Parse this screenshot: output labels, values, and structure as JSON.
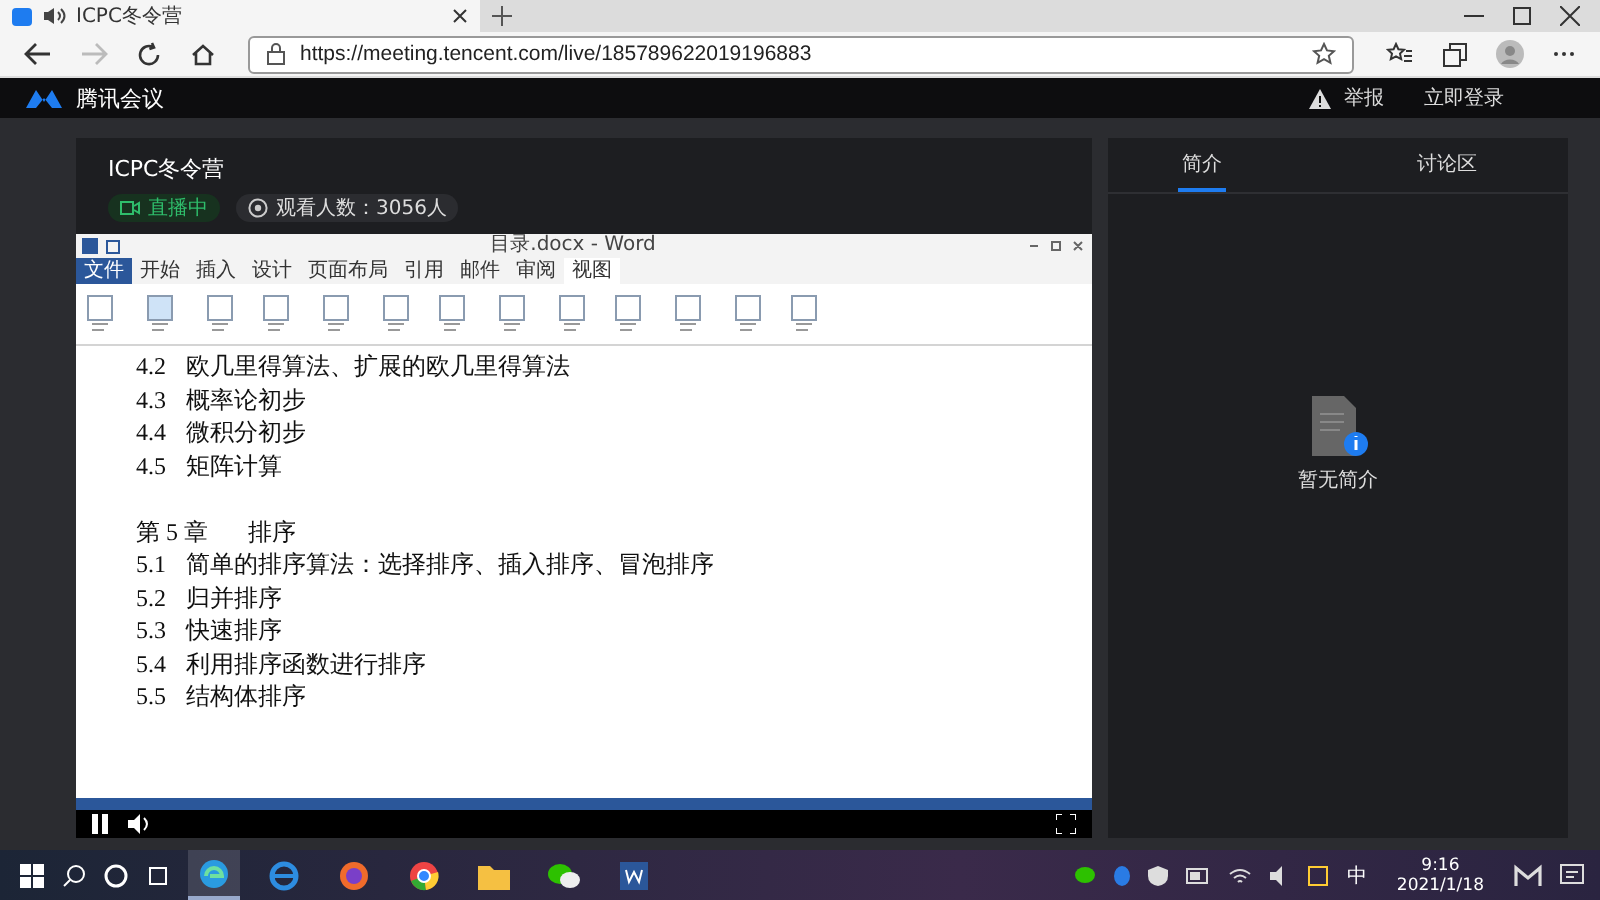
{
  "browser": {
    "tab_title": "ICPC冬令营",
    "url": "https://meeting.tencent.com/live/185789622019196883"
  },
  "site": {
    "logo": "腾讯会议",
    "actions": [
      "举报",
      "立即登录"
    ]
  },
  "live": {
    "title": "ICPC冬令营",
    "status": "直播中",
    "viewers": "观看人数：3056人"
  },
  "word": {
    "title": "目录.docx - Word",
    "tabs": [
      {
        "label": "文件",
        "selected": false
      },
      {
        "label": "开始",
        "selected": false
      },
      {
        "label": "插入",
        "selected": false
      },
      {
        "label": "设计",
        "selected": false
      },
      {
        "label": "页面布局",
        "selected": false
      },
      {
        "label": "引用",
        "selected": false
      },
      {
        "label": "邮件",
        "selected": false
      },
      {
        "label": "审阅",
        "selected": false
      },
      {
        "label": "视图",
        "selected": true
      }
    ],
    "lines": [
      {
        "num": "4.2",
        "text": "欧几里得算法、扩展的欧几里得算法"
      },
      {
        "num": "4.3",
        "text": "概率论初步"
      },
      {
        "num": "4.4",
        "text": "微积分初步"
      },
      {
        "num": "4.5",
        "text": "矩阵计算"
      },
      {
        "kind": "blank"
      },
      {
        "kind": "chapter",
        "num": "第 5 章",
        "text": "排序"
      },
      {
        "num": "5.1",
        "text": "简单的排序算法：选择排序、插入排序、冒泡排序"
      },
      {
        "num": "5.2",
        "text": "归并排序"
      },
      {
        "num": "5.3",
        "text": "快速排序"
      },
      {
        "num": "5.4",
        "text": "利用排序函数进行排序"
      },
      {
        "num": "5.5",
        "text": "结构体排序"
      }
    ]
  },
  "side": {
    "tabs": [
      {
        "label": "简介",
        "selected": true
      },
      {
        "label": "讨论区",
        "selected": false
      }
    ],
    "empty": "暂无简介"
  },
  "taskbar": {
    "ime": "中",
    "time": "9:16",
    "date": "2021/1/18"
  }
}
